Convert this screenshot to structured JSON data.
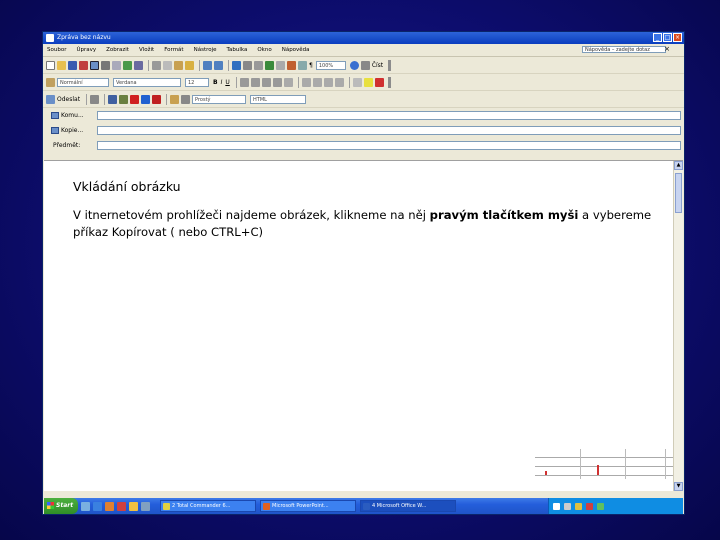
{
  "window": {
    "title": "Zpráva bez názvu"
  },
  "menu": {
    "items": [
      "Soubor",
      "Úpravy",
      "Zobrazit",
      "Vložit",
      "Formát",
      "Nástroje",
      "Tabulka",
      "Okno",
      "Nápověda"
    ],
    "help_placeholder": "Nápověda – zadejte dotaz"
  },
  "toolbar_standard": {
    "zoom": "100%",
    "read_label": "Číst"
  },
  "toolbar_format": {
    "style": "Normální",
    "font": "Verdana",
    "size": "12"
  },
  "toolbar_mail": {
    "send_label": "Odeslat",
    "format_value": "Prostý",
    "encoding_value": "HTML"
  },
  "header_fields": {
    "to_label": "Komu...",
    "cc_label": "Kopie...",
    "subject_label": "Předmět:"
  },
  "body": {
    "heading": "Vkládání obrázku",
    "para_part1": "V itnernetovém prohlížeči najdeme obrázek, klikneme na něj ",
    "para_bold": "pravým tlačítkem myši",
    "para_part2": " a vybereme příkaz Kopírovat ( nebo CTRL+C)"
  },
  "taskbar": {
    "start_label": "Start",
    "tasks": [
      "2 Total Commander 6...",
      "Microsoft PowerPoint...",
      "4 Microsoft Office W..."
    ]
  },
  "colors": {
    "desktop_bg": "#0d0d6e",
    "titlebar": "#0a3dbf",
    "taskbar": "#245edb",
    "start_button": "#2f8d27"
  }
}
